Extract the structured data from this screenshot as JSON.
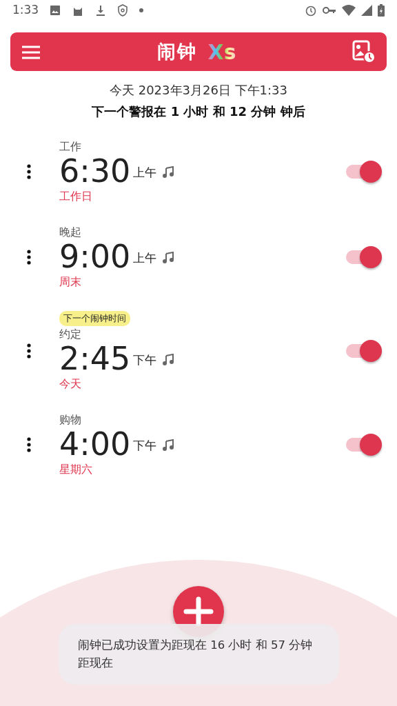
{
  "status_bar": {
    "time": "1:33"
  },
  "app_bar": {
    "title": "闹钟",
    "logo_text": "Xs"
  },
  "header": {
    "date": "今天 2023年3月26日 下午1:33",
    "next": "下一个警报在 1 小时 和 12 分钟 钟后"
  },
  "alarms": [
    {
      "label": "工作",
      "time": "6:30",
      "period": "上午",
      "days": "工作日",
      "on": true
    },
    {
      "label": "晚起",
      "time": "9:00",
      "period": "上午",
      "days": "周末",
      "on": true
    },
    {
      "badge": "下一个闹钟时间",
      "label": "约定",
      "time": "2:45",
      "period": "下午",
      "days": "今天",
      "on": true
    },
    {
      "label": "购物",
      "time": "4:00",
      "period": "下午",
      "days": "星期六",
      "on": true
    }
  ],
  "toast": "闹钟已成功设置为距现在 16 小时 和 57 分钟距现在"
}
